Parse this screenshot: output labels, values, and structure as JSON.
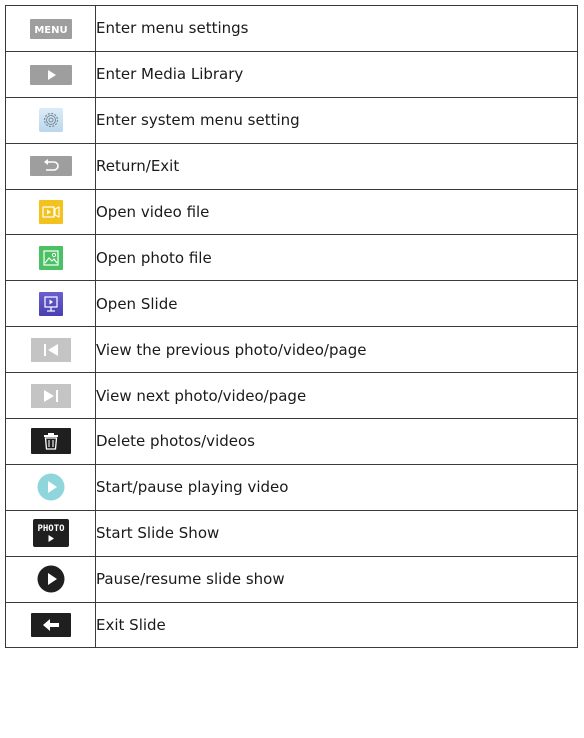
{
  "rows": [
    {
      "icon": "menu-key-icon",
      "label": "MENU",
      "description": "Enter menu settings"
    },
    {
      "icon": "play-arrow-icon",
      "description": "Enter Media Library"
    },
    {
      "icon": "gear-icon",
      "description": "Enter system menu setting"
    },
    {
      "icon": "return-icon",
      "description": "Return/Exit"
    },
    {
      "icon": "video-file-icon",
      "description": "Open video file"
    },
    {
      "icon": "photo-file-icon",
      "description": "Open photo file"
    },
    {
      "icon": "slide-icon",
      "description": "Open Slide"
    },
    {
      "icon": "previous-icon",
      "description": "View the previous photo/video/page"
    },
    {
      "icon": "next-icon",
      "description": "View next photo/video/page"
    },
    {
      "icon": "trash-icon",
      "description": "Delete photos/videos"
    },
    {
      "icon": "play-circle-icon",
      "description": "Start/pause playing video"
    },
    {
      "icon": "photo-slideshow-icon",
      "label": "PHOTO",
      "description": "Start Slide Show"
    },
    {
      "icon": "pause-resume-icon",
      "description": "Pause/resume slide show"
    },
    {
      "icon": "exit-slide-icon",
      "description": "Exit Slide"
    }
  ],
  "colors": {
    "grey_key": "#9e9e9e",
    "dark_key": "#1f1f1f",
    "video_yellow": "#f3c21f",
    "photo_green": "#49c164",
    "slide_purple": "#5a4fc0",
    "cyan_play": "#8fd6dc"
  }
}
